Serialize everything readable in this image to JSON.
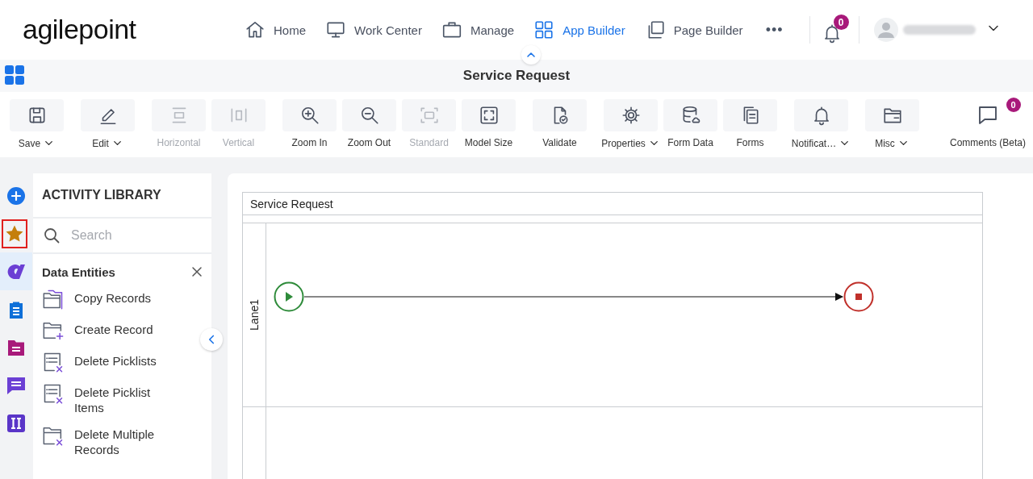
{
  "header": {
    "logo": "agilepoint",
    "nav": [
      {
        "label": "Home",
        "selected": false
      },
      {
        "label": "Work Center",
        "selected": false
      },
      {
        "label": "Manage",
        "selected": false
      },
      {
        "label": "App Builder",
        "selected": true
      },
      {
        "label": "Page Builder",
        "selected": false
      }
    ],
    "more": "•••",
    "notifications": {
      "badge": "0"
    }
  },
  "title_bar": {
    "title": "Service Request"
  },
  "toolbar": {
    "groups": [
      [
        {
          "label": "Save",
          "disabled": false,
          "dropdown": true
        }
      ],
      [
        {
          "label": "Edit",
          "disabled": false,
          "dropdown": true
        }
      ],
      [
        {
          "label": "Horizontal",
          "disabled": true,
          "dropdown": false
        },
        {
          "label": "Vertical",
          "disabled": true,
          "dropdown": false
        }
      ],
      [
        {
          "label": "Zoom In",
          "disabled": false,
          "dropdown": false
        },
        {
          "label": "Zoom Out",
          "disabled": false,
          "dropdown": false
        },
        {
          "label": "Standard",
          "disabled": true,
          "dropdown": false
        },
        {
          "label": "Model Size",
          "disabled": false,
          "dropdown": false
        }
      ],
      [
        {
          "label": "Validate",
          "disabled": false,
          "dropdown": false
        }
      ],
      [
        {
          "label": "Properties",
          "disabled": false,
          "dropdown": true
        },
        {
          "label": "Form Data",
          "disabled": false,
          "dropdown": false
        },
        {
          "label": "Forms",
          "disabled": false,
          "dropdown": false
        }
      ],
      [
        {
          "label": "Notificat…",
          "disabled": false,
          "dropdown": true
        }
      ],
      [
        {
          "label": "Misc",
          "disabled": false,
          "dropdown": true
        }
      ]
    ],
    "comments": {
      "label": "Comments (Beta)",
      "badge": "0"
    }
  },
  "rail": [
    {
      "color": "#1a73e8",
      "selected": false,
      "highlighted": false
    },
    {
      "color": "#c47f0b",
      "selected": false,
      "highlighted": true
    },
    {
      "color": "#6b3fd4",
      "selected": true,
      "highlighted": false
    },
    {
      "color": "#0e6fd8",
      "selected": false,
      "highlighted": false
    },
    {
      "color": "#a8197a",
      "selected": false,
      "highlighted": false
    },
    {
      "color": "#6b3fd4",
      "selected": false,
      "highlighted": false
    },
    {
      "color": "#5a35c8",
      "selected": false,
      "highlighted": false
    }
  ],
  "library": {
    "title": "ACTIVITY LIBRARY",
    "search": {
      "placeholder": "Search"
    },
    "category": {
      "title": "Data Entities",
      "items": [
        {
          "label": "Copy Records"
        },
        {
          "label": "Create Record"
        },
        {
          "label": "Delete Picklists"
        },
        {
          "label": "Delete Picklist Items"
        },
        {
          "label": "Delete Multiple Records"
        }
      ]
    }
  },
  "canvas": {
    "pool": {
      "title": "Service Request",
      "lanes": [
        {
          "label": "Lane1",
          "flow": true
        },
        {
          "flow": false
        }
      ]
    }
  }
}
